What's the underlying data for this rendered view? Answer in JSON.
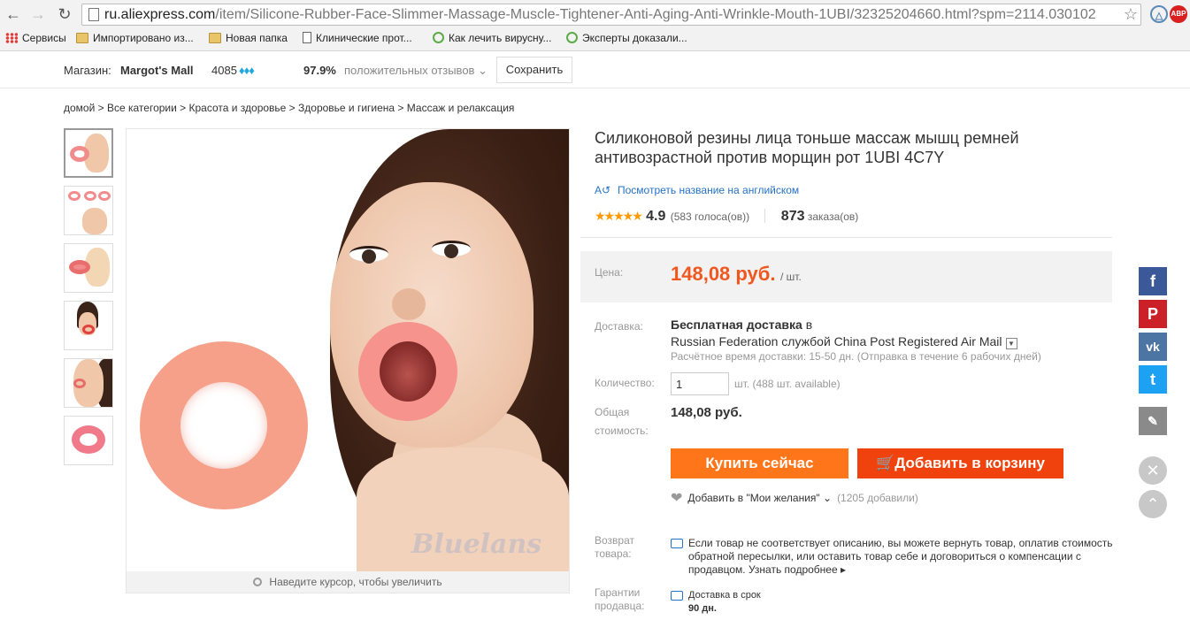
{
  "browser": {
    "url_host": "ru.aliexpress.com",
    "url_path": "/item/Silicone-Rubber-Face-Slimmer-Massage-Muscle-Tightener-Anti-Aging-Anti-Wrinkle-Mouth-1UBI/32325204660.html?spm=2114.030102",
    "ext_abp": "ABP",
    "bookmarks": [
      {
        "label": "Сервисы",
        "icon": "apps-icon"
      },
      {
        "label": "Импортировано из...",
        "icon": "folder-icon"
      },
      {
        "label": "Новая папка",
        "icon": "folder-icon"
      },
      {
        "label": "Клинические прот...",
        "icon": "document-icon"
      },
      {
        "label": "Как лечить вирусну...",
        "icon": "swirl-icon"
      },
      {
        "label": "Эксперты доказали...",
        "icon": "swirl-icon"
      }
    ]
  },
  "store": {
    "label": "Магазин:",
    "name": "Margot's Mall",
    "score": "4085",
    "feedback_pct": "97.9%",
    "feedback_label": "положительных отзывов",
    "save_label": "Сохранить"
  },
  "breadcrumb": "домой > Все категории > Красота и здоровье > Здоровье и гигиена > Массаж и релаксация",
  "gallery": {
    "zoom_hint": "Наведите курсор, чтобы увеличить",
    "watermark": "Bluelans"
  },
  "product": {
    "title": "Силиконовой резины лица тоньше массаж мышц ремней антивозрастной против морщин рот 1UBI 4C7Y",
    "translate_label": "Посмотреть название на английском",
    "rating": "4.9",
    "votes": "(583 голоса(ов))",
    "orders": "873",
    "orders_label": "заказа(ов)",
    "price_label": "Цена:",
    "price": "148,08 руб.",
    "price_unit": "/ шт.",
    "shipping_label": "Доставка:",
    "shipping_free": "Бесплатная доставка",
    "shipping_in": "в",
    "shipping_route": "Russian Federation службой China Post Registered Air Mail",
    "shipping_estimate": "Расчётное время доставки: 15-50 дн. (Отправка в течение 6 рабочих дней)",
    "qty_label": "Количество:",
    "qty_value": "1",
    "qty_note": "шт. (488 шт. available)",
    "total_label_1": "Общая",
    "total_label_2": "стоимость:",
    "total": "148,08 руб.",
    "buy_label": "Купить сейчас",
    "cart_label": "Добавить в корзину",
    "wish_label": "Добавить в \"Мои желания\"",
    "wish_count": "(1205 добавили)",
    "return_label_1": "Возврат",
    "return_label_2": "товара:",
    "return_text": "Если товар не соответствует описанию, вы можете вернуть товар, оплатив стоимость обратной пересылки, или оставить товар себе и договориться о компенсации с продавцом. Узнать подробнее",
    "guarantee_label_1": "Гарантии",
    "guarantee_label_2": "продавца:",
    "guarantee_text": "Доставка в срок",
    "guarantee_days": "90 дн."
  },
  "social": {
    "facebook": "f",
    "pinterest": "P",
    "vk": "vk",
    "twitter": "t"
  },
  "colors": {
    "price": "#f0571e",
    "buy": "#ff7519",
    "cart": "#f0420c",
    "link": "#2672c4"
  }
}
